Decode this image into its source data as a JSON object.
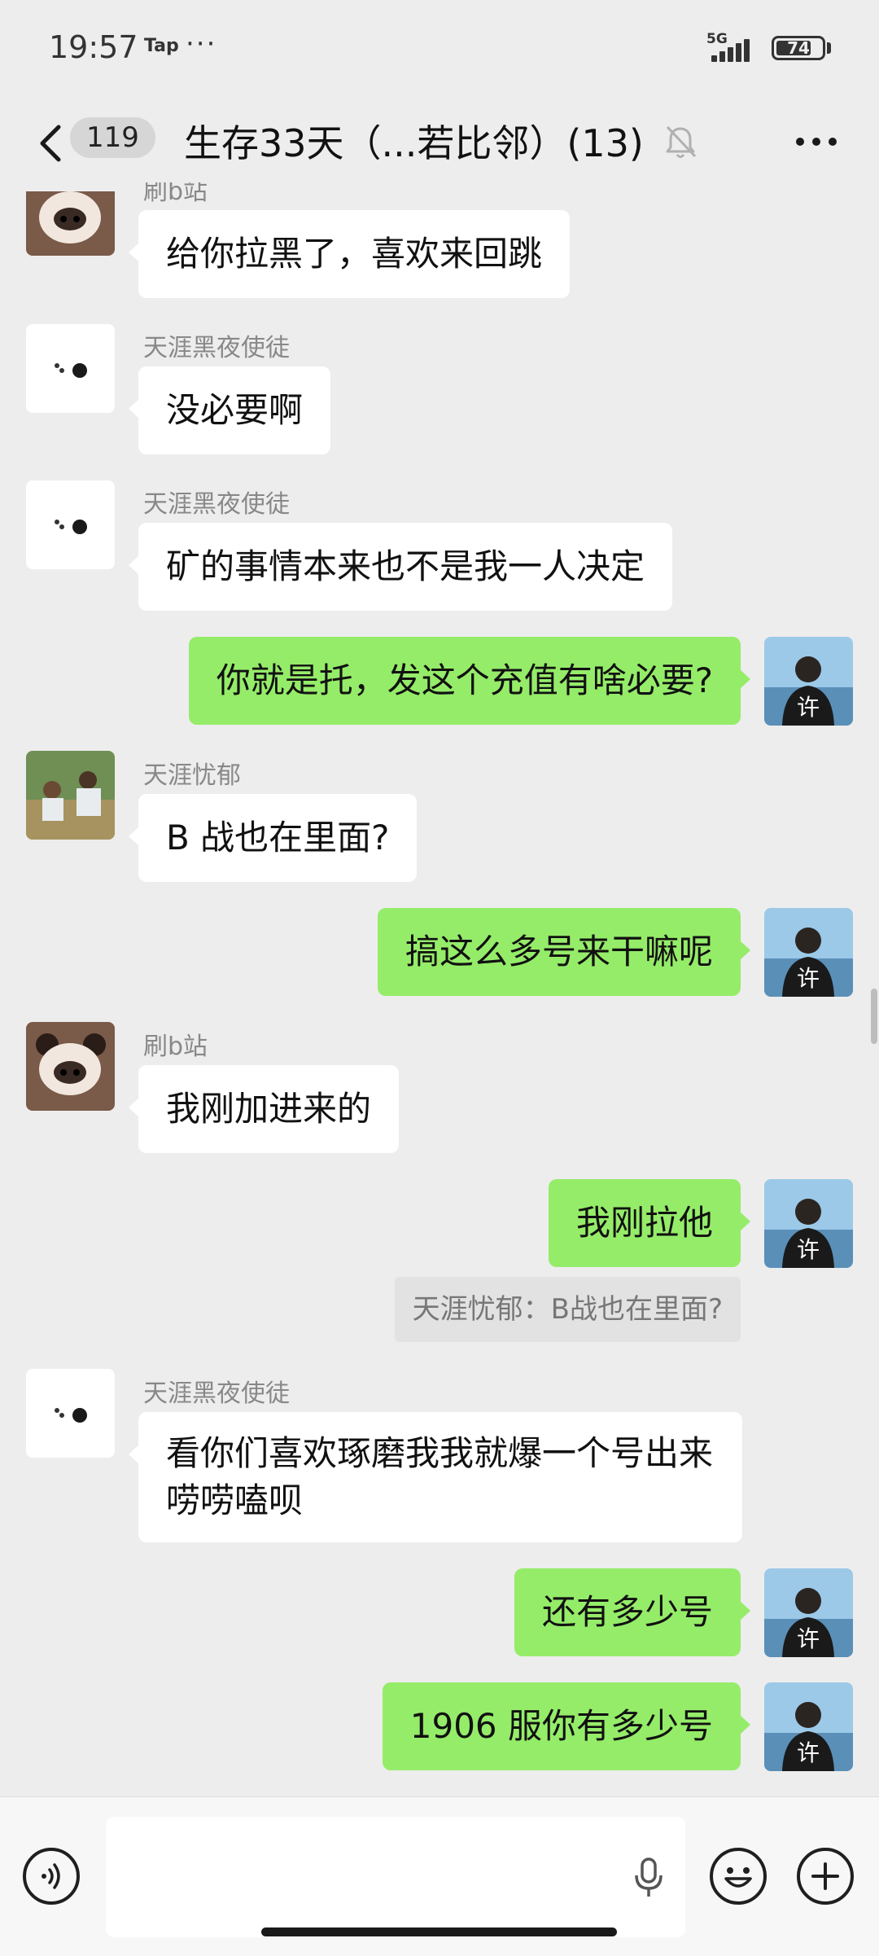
{
  "status_bar": {
    "time": "19:57",
    "app": "Tap",
    "dots": "···",
    "network": "5G",
    "battery": "74"
  },
  "header": {
    "unread_count": "119",
    "title": "生存33天（...若比邻）(13)"
  },
  "messages": {
    "m0": {
      "sender": "刷b站",
      "text": "给你拉黑了，喜欢来回跳"
    },
    "m1": {
      "sender": "天涯黑夜使徒",
      "text": "没必要啊"
    },
    "m2": {
      "sender": "天涯黑夜使徒",
      "text": "矿的事情本来也不是我一人决定"
    },
    "m3": {
      "text": "你就是托，发这个充值有啥必要?"
    },
    "m4": {
      "sender": "天涯忧郁",
      "text": "B 战也在里面?"
    },
    "m5": {
      "text": "搞这么多号来干嘛呢"
    },
    "m6": {
      "sender": "刷b站",
      "text": "我刚加进来的"
    },
    "m7": {
      "text": "我刚拉他",
      "quote": "天涯忧郁：B战也在里面?"
    },
    "m8": {
      "sender": "天涯黑夜使徒",
      "text": "看你们喜欢琢磨我我就爆一个号出来唠唠嗑呗"
    },
    "m9": {
      "text": "还有多少号"
    },
    "m10": {
      "text": "1906 服你有多少号"
    }
  },
  "colors": {
    "background": "#ededed",
    "outgoing_bubble": "#95ec69",
    "incoming_bubble": "#ffffff",
    "input_bar": "#f7f7f7"
  },
  "icons": {
    "back": "chevron-left-icon",
    "mute": "bell-off-icon",
    "more": "more-icon",
    "voice": "voice-icon",
    "mic": "mic-icon",
    "emoji": "emoji-icon",
    "add": "plus-icon"
  }
}
